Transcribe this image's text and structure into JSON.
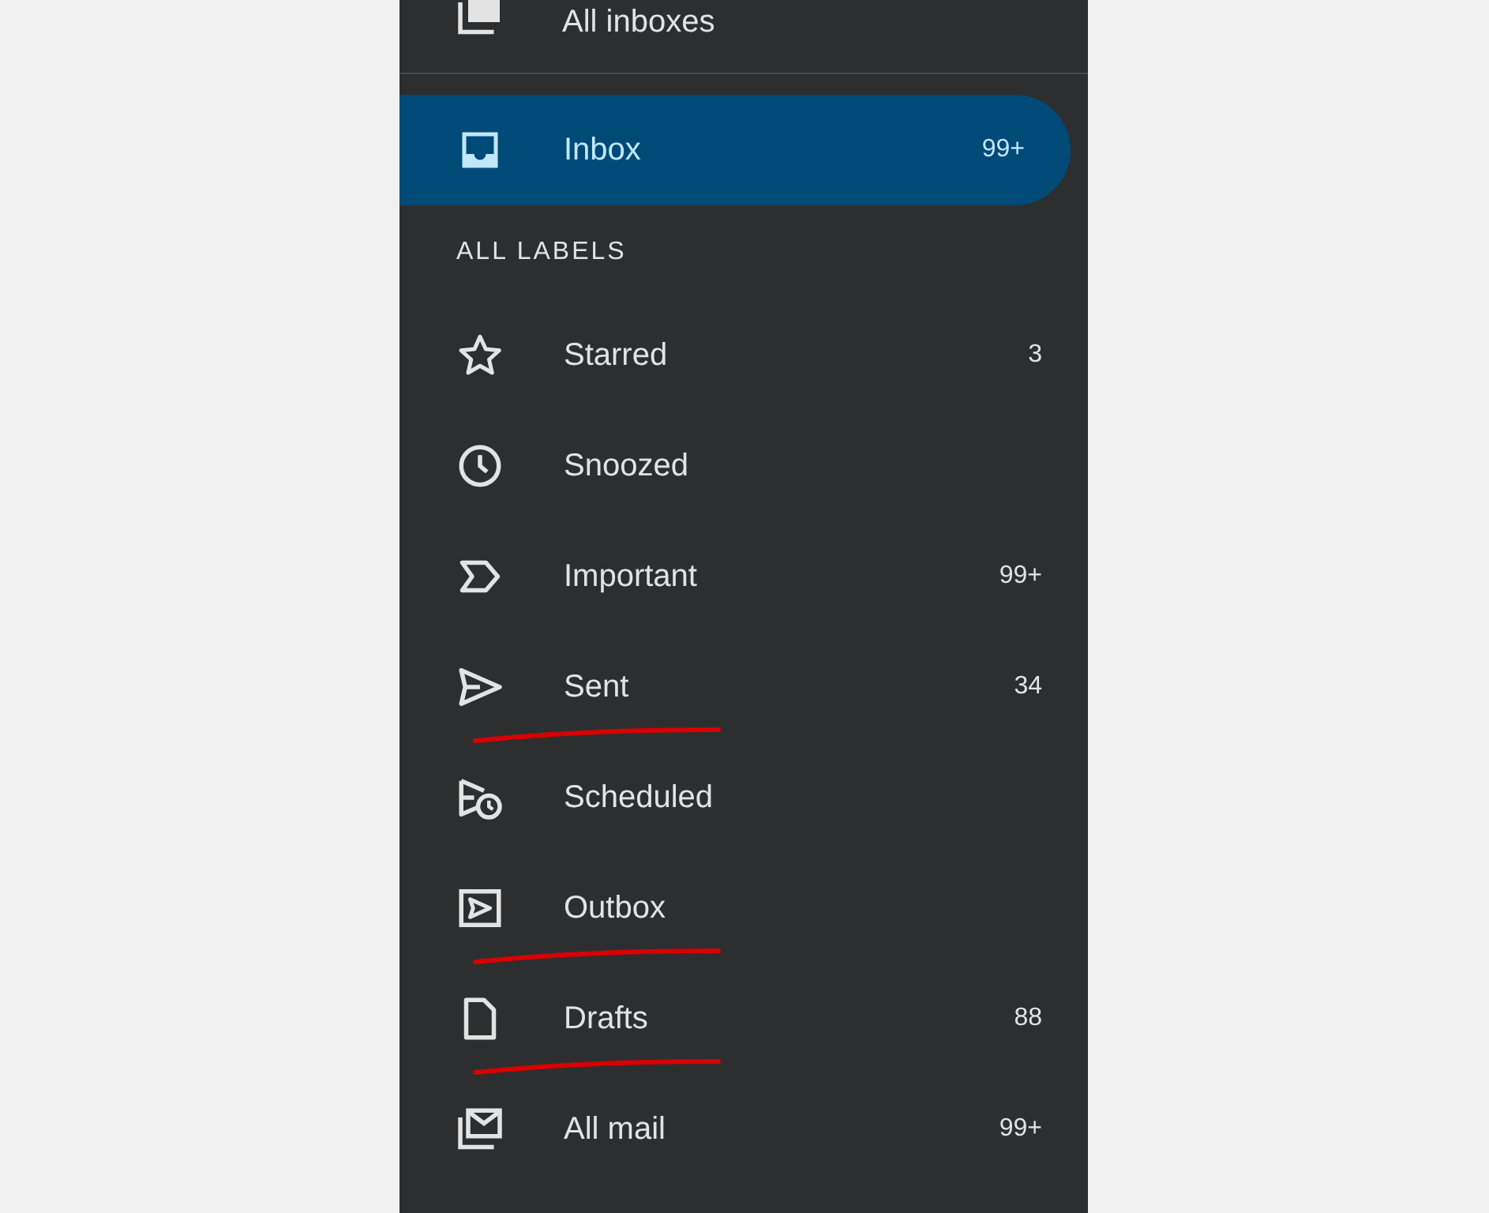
{
  "top_item": {
    "label": "All inboxes"
  },
  "primary": {
    "label": "Inbox",
    "count": "99+",
    "selected": true
  },
  "section_title": "ALL LABELS",
  "labels": [
    {
      "label": "Starred",
      "count": "3",
      "selected": false,
      "annotated": false
    },
    {
      "label": "Snoozed",
      "selected": false,
      "annotated": false
    },
    {
      "label": "Important",
      "count": "99+",
      "selected": false,
      "annotated": false
    },
    {
      "label": "Sent",
      "count": "34",
      "selected": false,
      "annotated": true
    },
    {
      "label": "Scheduled",
      "selected": false,
      "annotated": false
    },
    {
      "label": "Outbox",
      "selected": false,
      "annotated": true
    },
    {
      "label": "Drafts",
      "count": "88",
      "selected": false,
      "annotated": true
    },
    {
      "label": "All mail",
      "count": "99+",
      "selected": false,
      "annotated": false
    }
  ]
}
